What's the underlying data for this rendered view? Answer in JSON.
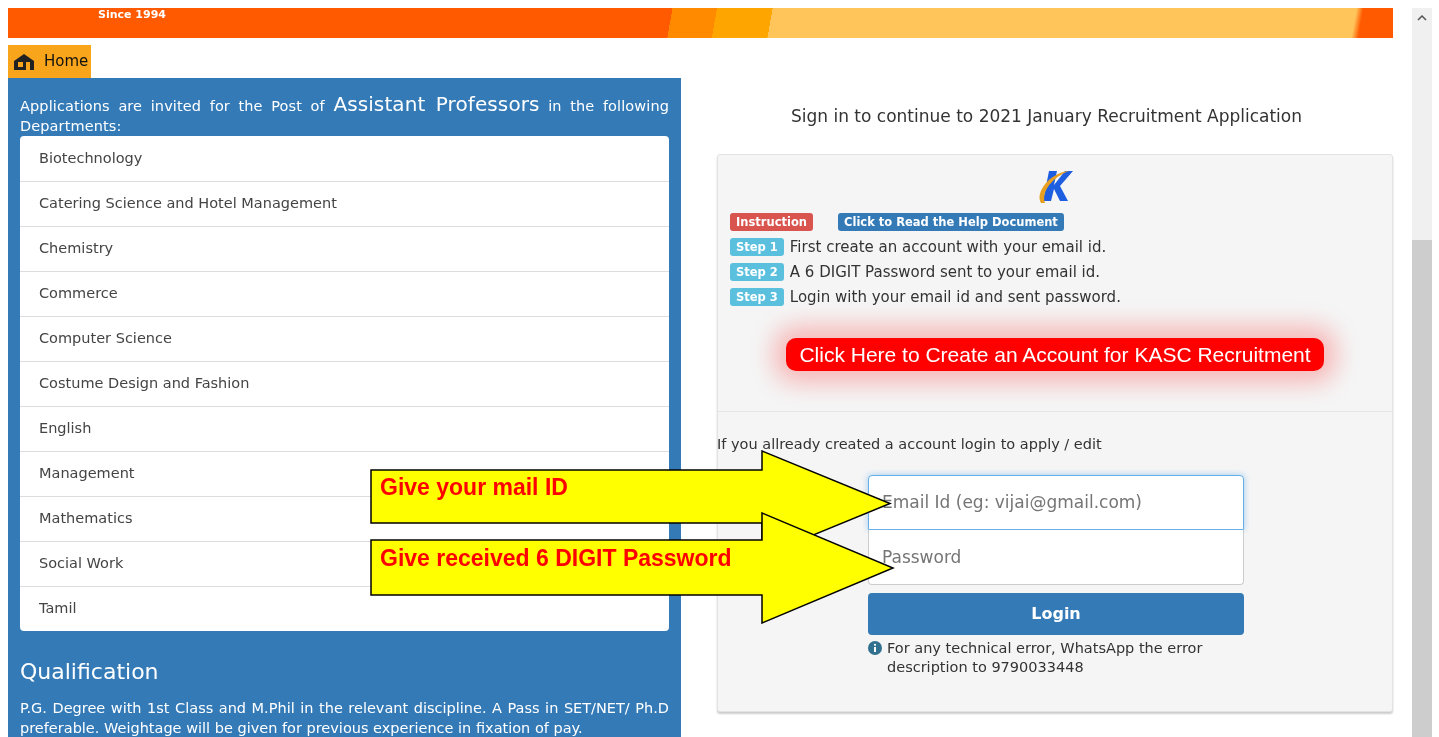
{
  "banner": {
    "tagline": "Since 1994"
  },
  "home_tab": {
    "label": "Home"
  },
  "left_panel": {
    "intro": "Applications are invited for the Post of **Assistant Professors** in the following Departments:",
    "departments": [
      {
        "name": "Biotechnology"
      },
      {
        "name": "Catering Science and Hotel Management"
      },
      {
        "name": "Chemistry"
      },
      {
        "name": "Commerce"
      },
      {
        "name": "Computer Science"
      },
      {
        "name": "Costume Design and Fashion"
      },
      {
        "name": "English"
      },
      {
        "name": "Management"
      },
      {
        "name": "Mathematics"
      },
      {
        "name": "Social Work"
      },
      {
        "name": "Tamil"
      }
    ],
    "qualification_title": "Qualification",
    "qualification_text": "P.G. Degree with 1st Class and M.Phil in the relevant discipline. A Pass in SET/NET/ Ph.D preferable. Weightage will be given for previous experience in fixation of pay."
  },
  "sign_in": {
    "heading": "Sign in to continue to 2021 January Recruitment Application",
    "instruction_badge": "Instruction",
    "help_button": "Click to Read the Help Document",
    "steps": [
      {
        "badge": "Step 1",
        "text": "First create an account with your email id."
      },
      {
        "badge": "Step 2",
        "text": "A 6 DIGIT Password sent to your email id."
      },
      {
        "badge": "Step 3",
        "text": "Login with your email id and sent password."
      }
    ],
    "create_account_button": "Click Here to Create an Account for KASC Recruitment",
    "login_prompt": "If you allready created a account login to apply / edit",
    "email": {
      "placeholder": "Email Id (eg: vijai@gmail.com)"
    },
    "password": {
      "placeholder": "Password"
    },
    "login_button": "Login",
    "help_note": "For any technical error, WhatsApp the error description to 9790033448"
  },
  "callouts": [
    {
      "text": "Give your mail ID"
    },
    {
      "text": "Give received 6 DIGIT Password"
    }
  ]
}
